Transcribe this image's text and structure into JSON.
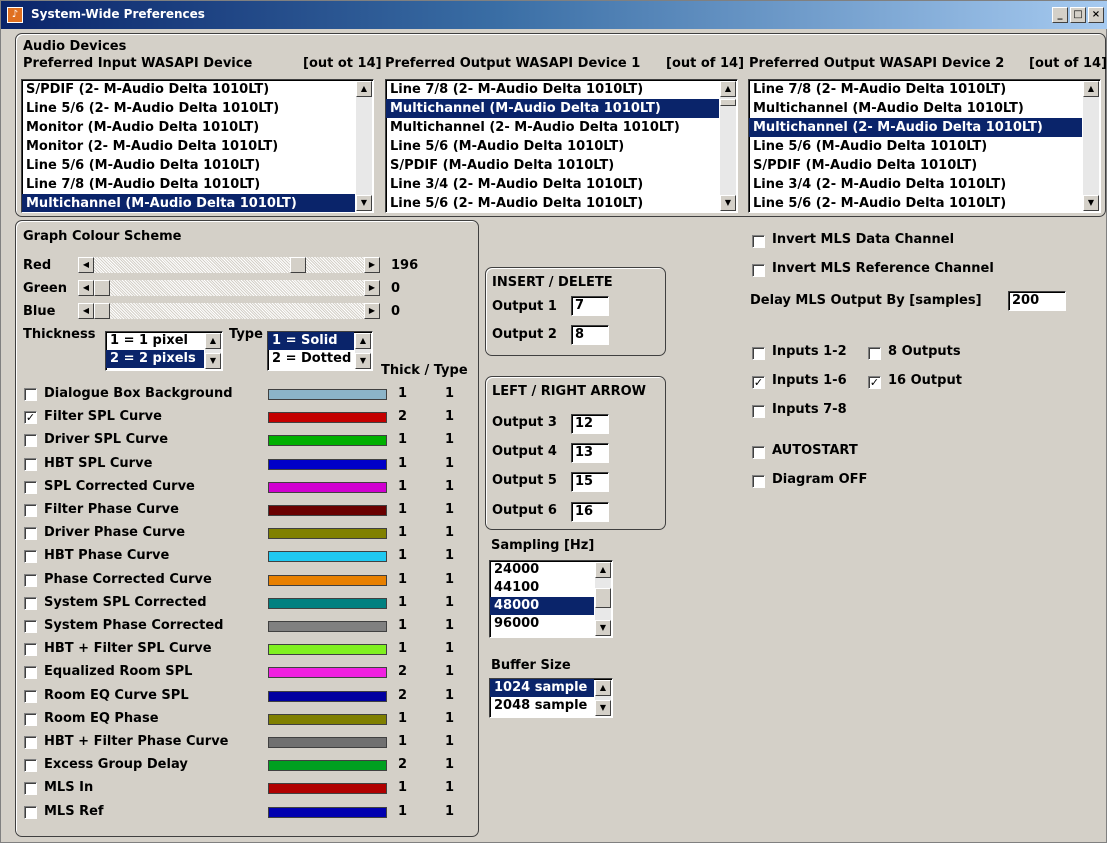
{
  "window": {
    "title": "System-Wide Preferences",
    "controls": [
      "_",
      "□",
      "×"
    ]
  },
  "audio": {
    "section_label": "Audio Devices",
    "input_header": "Preferred Input WASAPI Device",
    "input_count": "[out ot 14]",
    "out1_header": "Preferred Output WASAPI Device 1",
    "out1_count": "[out of 14]",
    "out2_header": "Preferred Output WASAPI Device 2",
    "out2_count": "[out of 14]",
    "input_list": [
      "S/PDIF (2- M-Audio Delta 1010LT)",
      "Line 5/6 (2- M-Audio Delta 1010LT)",
      "Monitor (M-Audio Delta 1010LT)",
      "Monitor (2- M-Audio Delta 1010LT)",
      "Line 5/6 (M-Audio Delta 1010LT)",
      "Line 7/8 (M-Audio Delta 1010LT)",
      "Multichannel (M-Audio Delta 1010LT)"
    ],
    "input_selected": 6,
    "out1_list": [
      "Line 7/8 (2- M-Audio Delta 1010LT)",
      "Multichannel (M-Audio Delta 1010LT)",
      "Multichannel (2- M-Audio Delta 1010LT)",
      "Line 5/6 (M-Audio Delta 1010LT)",
      "S/PDIF (M-Audio Delta 1010LT)",
      "Line 3/4 (2- M-Audio Delta 1010LT)",
      "Line 5/6 (2- M-Audio Delta 1010LT)"
    ],
    "out1_selected": 1,
    "out2_list": [
      "Line 7/8 (2- M-Audio Delta 1010LT)",
      "Multichannel (M-Audio Delta 1010LT)",
      "Multichannel (2- M-Audio Delta 1010LT)",
      "Line 5/6 (M-Audio Delta 1010LT)",
      "S/PDIF (M-Audio Delta 1010LT)",
      "Line 3/4 (2- M-Audio Delta 1010LT)",
      "Line 5/6 (2- M-Audio Delta 1010LT)"
    ],
    "out2_selected": 2
  },
  "graph": {
    "title": "Graph Colour Scheme",
    "red_label": "Red",
    "red_value": "196",
    "green_label": "Green",
    "green_value": "0",
    "blue_label": "Blue",
    "blue_value": "0",
    "red_level": 0.77,
    "green_level": 0,
    "blue_level": 0,
    "thickness_label": "Thickness",
    "thickness_options": [
      "1 = 1 pixel",
      "2 = 2 pixels"
    ],
    "thickness_selected": 1,
    "type_label": "Type",
    "type_options": [
      "1 = Solid",
      "2 = Dotted"
    ],
    "type_selected": 0,
    "thick_type_header": "Thick / Type",
    "curves": [
      {
        "label": "Dialogue Box Background",
        "checked": false,
        "color": "#8cb4c8",
        "thick": "1",
        "type": "1"
      },
      {
        "label": "Filter SPL Curve",
        "checked": true,
        "color": "#c40000",
        "thick": "2",
        "type": "1"
      },
      {
        "label": "Driver SPL Curve",
        "checked": false,
        "color": "#00b000",
        "thick": "1",
        "type": "1"
      },
      {
        "label": "HBT SPL Curve",
        "checked": false,
        "color": "#0000c8",
        "thick": "1",
        "type": "1"
      },
      {
        "label": "SPL Corrected Curve",
        "checked": false,
        "color": "#d000d0",
        "thick": "1",
        "type": "1"
      },
      {
        "label": "Filter Phase Curve",
        "checked": false,
        "color": "#6a0000",
        "thick": "1",
        "type": "1"
      },
      {
        "label": "Driver Phase Curve",
        "checked": false,
        "color": "#808000",
        "thick": "1",
        "type": "1"
      },
      {
        "label": "HBT Phase Curve",
        "checked": false,
        "color": "#20c8f0",
        "thick": "1",
        "type": "1"
      },
      {
        "label": "Phase Corrected Curve",
        "checked": false,
        "color": "#e88000",
        "thick": "1",
        "type": "1"
      },
      {
        "label": "System SPL Corrected",
        "checked": false,
        "color": "#008080",
        "thick": "1",
        "type": "1"
      },
      {
        "label": "System Phase Corrected",
        "checked": false,
        "color": "#808080",
        "thick": "1",
        "type": "1"
      },
      {
        "label": "HBT + Filter SPL Curve",
        "checked": false,
        "color": "#80f020",
        "thick": "1",
        "type": "1"
      },
      {
        "label": "Equalized Room SPL",
        "checked": false,
        "color": "#f020e0",
        "thick": "2",
        "type": "1"
      },
      {
        "label": "Room EQ Curve SPL",
        "checked": false,
        "color": "#0000a0",
        "thick": "2",
        "type": "1"
      },
      {
        "label": "Room EQ Phase",
        "checked": false,
        "color": "#808000",
        "thick": "1",
        "type": "1"
      },
      {
        "label": "HBT + Filter Phase Curve",
        "checked": false,
        "color": "#707070",
        "thick": "1",
        "type": "1"
      },
      {
        "label": "Excess Group Delay",
        "checked": false,
        "color": "#00a020",
        "thick": "2",
        "type": "1"
      },
      {
        "label": "MLS In",
        "checked": false,
        "color": "#b00000",
        "thick": "1",
        "type": "1"
      },
      {
        "label": "MLS Ref",
        "checked": false,
        "color": "#0000b0",
        "thick": "1",
        "type": "1"
      }
    ]
  },
  "insert": {
    "title": "INSERT / DELETE",
    "o1_label": "Output 1",
    "o1": "7",
    "o2_label": "Output 2",
    "o2": "8"
  },
  "arrows": {
    "title": "LEFT / RIGHT ARROW",
    "o3_label": "Output 3",
    "o3": "12",
    "o4_label": "Output 4",
    "o4": "13",
    "o5_label": "Output 5",
    "o5": "15",
    "o6_label": "Output 6",
    "o6": "16"
  },
  "sampling": {
    "label": "Sampling [Hz]",
    "options": [
      "24000",
      "44100",
      "48000",
      "96000"
    ],
    "selected": 2
  },
  "buffer": {
    "label": "Buffer Size",
    "options": [
      "1024 sample",
      "2048 sample"
    ],
    "selected": 0
  },
  "right": {
    "invert_data": "Invert MLS Data Channel",
    "invert_data_checked": false,
    "invert_ref": "Invert MLS Reference Channel",
    "invert_ref_checked": false,
    "delay_label": "Delay MLS Output By [samples]",
    "delay_value": "200",
    "inputs12": "Inputs 1-2",
    "inputs12_checked": false,
    "out8": "8 Outputs",
    "out8_checked": false,
    "inputs16": "Inputs 1-6",
    "inputs16_checked": true,
    "out16": "16 Output",
    "out16_checked": true,
    "inputs78": "Inputs 7-8",
    "inputs78_checked": false,
    "autostart": "AUTOSTART",
    "autostart_checked": false,
    "diagram": "Diagram OFF",
    "diagram_checked": false
  }
}
